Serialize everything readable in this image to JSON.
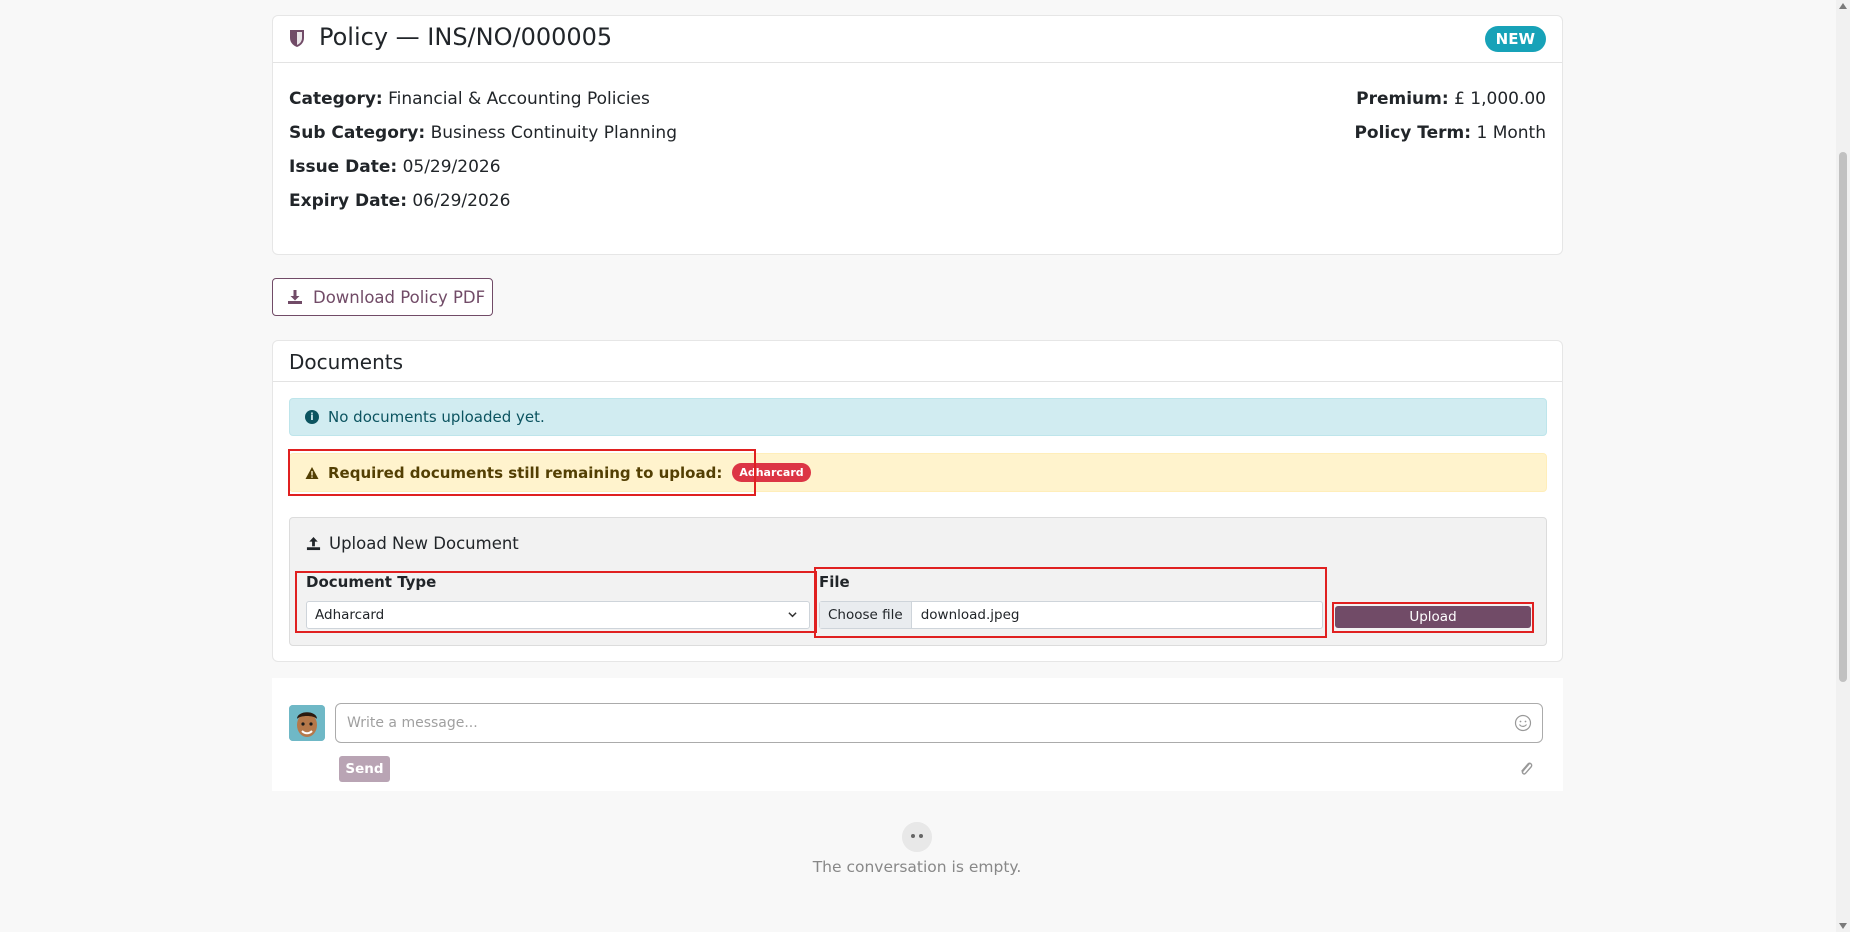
{
  "policy": {
    "title": "Policy — INS/NO/000005",
    "status_badge": "NEW",
    "category_label": "Category:",
    "category_value": "Financial & Accounting Policies",
    "sub_category_label": "Sub Category:",
    "sub_category_value": "Business Continuity Planning",
    "issue_date_label": "Issue Date:",
    "issue_date_value": "05/29/2026",
    "expiry_date_label": "Expiry Date:",
    "expiry_date_value": "06/29/2026",
    "premium_label": "Premium:",
    "premium_value": "£ 1,000.00",
    "term_label": "Policy Term:",
    "term_value": "1 Month"
  },
  "download_button": "Download Policy PDF",
  "documents": {
    "title": "Documents",
    "no_docs_message": "No documents uploaded yet.",
    "required_message": "Required documents still remaining to upload:",
    "required_badge": "Adharcard",
    "upload": {
      "title": "Upload New Document",
      "doc_type_label": "Document Type",
      "doc_type_value": "Adharcard",
      "file_label": "File",
      "choose_file": "Choose file",
      "file_name": "download.jpeg",
      "upload_button": "Upload"
    }
  },
  "chatter": {
    "message_placeholder": "Write a message...",
    "send_button": "Send",
    "empty_text": "The conversation is empty."
  },
  "colors": {
    "brand": "#714B67",
    "info": "#17a2b8",
    "danger": "#dc3545"
  },
  "icons": [
    "shield-icon",
    "download-icon",
    "info-icon",
    "warning-icon",
    "upload-icon",
    "chevron-down-icon",
    "smile-icon",
    "paperclip-icon"
  ]
}
